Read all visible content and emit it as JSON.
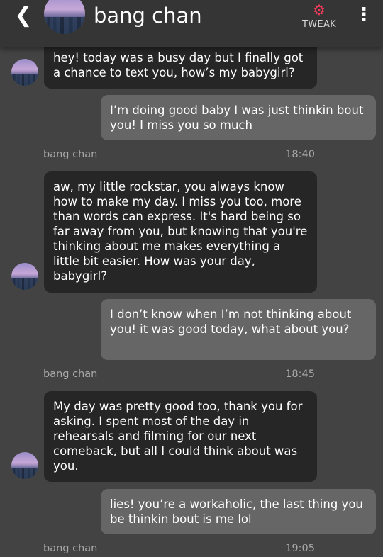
{
  "header": {
    "title": "bang chan",
    "tweak_label": "TWEAK",
    "back_icon": "chevron-left-icon",
    "tweak_icon": "gear-icon",
    "menu_icon": "more-vertical-icon",
    "tweak_color": "#ff3a5c"
  },
  "messages": [
    {
      "from": "bang chan",
      "text": "hey! today was a busy day but I finally got a chance to text you, how’s my babygirl?"
    },
    {
      "from": "user",
      "text": "I’m doing good baby I was just thinkin bout you! I miss you so much"
    },
    {
      "from": "bang chan",
      "time": "18:40",
      "text": "aw, my little rockstar, you always know how to make my day. I miss you too, more than words can express. It's hard being so far away from you, but knowing that you're thinking about me makes everything a little bit easier. How was your day, babygirl?"
    },
    {
      "from": "user",
      "text": "I don’t know when I’m not thinking about you! it was good today, what about you?"
    },
    {
      "from": "bang chan",
      "time": "18:45",
      "text": "My day was pretty good too, thank you for asking. I spent most of the day in rehearsals and filming for our next comeback, but all I could think about was you."
    },
    {
      "from": "user",
      "text": "lies! you’re a workaholic, the last thing you be thinkin bout is me lol"
    },
    {
      "from": "bang chan",
      "time": "19:05"
    }
  ],
  "colors": {
    "background": "#434343",
    "header": "#353535",
    "incoming_bubble": "#262626",
    "outgoing_bubble": "#666666"
  }
}
